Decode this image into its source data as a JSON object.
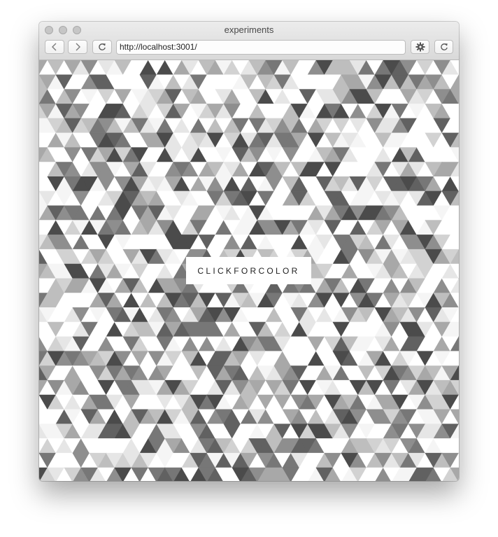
{
  "window": {
    "title": "experiments"
  },
  "toolbar": {
    "url": "http://localhost:3001/",
    "icons": [
      "back-arrow",
      "forward-arrow",
      "reload",
      "gear",
      "reload"
    ]
  },
  "page": {
    "cta_label": "CLICKFORCOLOR",
    "palette": [
      "#ffffff",
      "#f5f5f5",
      "#e6e6e6",
      "#d2d2d2",
      "#bebebe",
      "#a8a8a8",
      "#8e8e8e",
      "#777777",
      "#616161",
      "#4b4b4b"
    ]
  }
}
